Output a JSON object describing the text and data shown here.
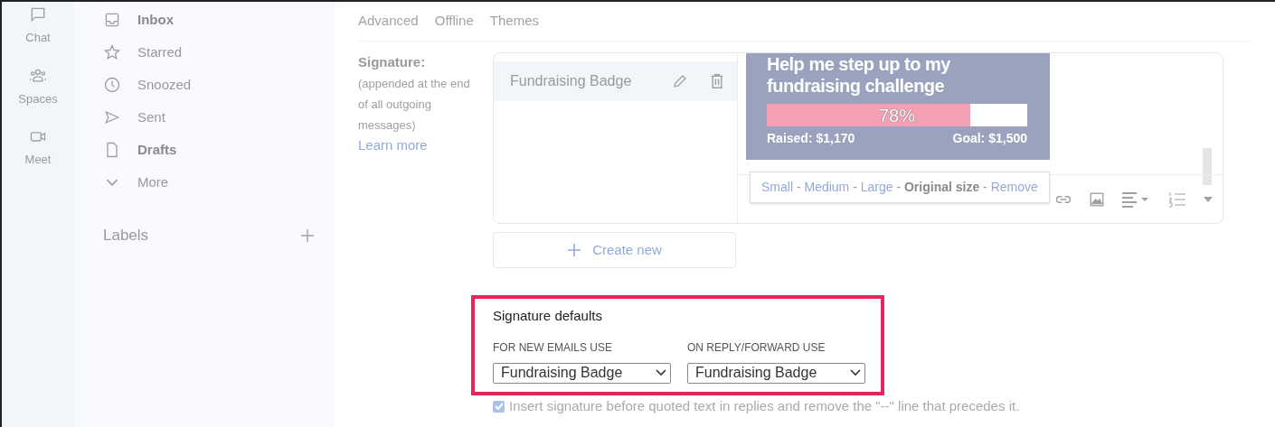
{
  "rail": [
    {
      "label": "Chat",
      "kind": "chat"
    },
    {
      "label": "Spaces",
      "kind": "spaces"
    },
    {
      "label": "Meet",
      "kind": "meet"
    }
  ],
  "nav": [
    {
      "label": "Inbox",
      "kind": "inbox",
      "bold": true
    },
    {
      "label": "Starred",
      "kind": "star",
      "bold": false
    },
    {
      "label": "Snoozed",
      "kind": "clock",
      "bold": false
    },
    {
      "label": "Sent",
      "kind": "send",
      "bold": false
    },
    {
      "label": "Drafts",
      "kind": "file",
      "bold": true
    },
    {
      "label": "More",
      "kind": "chevron",
      "bold": false
    }
  ],
  "labels": {
    "title": "Labels"
  },
  "tabs": [
    {
      "label": "Advanced",
      "selected": false
    },
    {
      "label": "Offline",
      "selected": false
    },
    {
      "label": "Themes",
      "selected": false
    }
  ],
  "signature": {
    "title": "Signature:",
    "note": "(appended at the end of all outgoing messages)",
    "link": "Learn more",
    "items": [
      {
        "name": "Fundraising Badge",
        "selected": true
      }
    ],
    "create": "Create new",
    "badge": {
      "heading": "Help me step up to my fundraising challenge",
      "percent": "78%",
      "level": 0.78,
      "raised": "Raised: $1,170",
      "goal": "Goal: $1,500"
    },
    "size_separator": "-",
    "size_options": [
      {
        "label": "Small",
        "selected": false
      },
      {
        "label": "Medium",
        "selected": false
      },
      {
        "label": "Large",
        "selected": false
      },
      {
        "label": "Original size",
        "selected": true
      },
      {
        "label": "Remove",
        "selected": false
      }
    ]
  },
  "defaults": {
    "title": "Signature defaults",
    "new_label": "FOR NEW EMAILS USE",
    "new_value": "Fundraising Badge",
    "reply_label": "ON REPLY/FORWARD USE",
    "reply_value": "Fundraising Badge"
  },
  "insert_before": {
    "label": "Insert signature before quoted text in replies and remove the \"--\" line that precedes it.",
    "checked": true
  }
}
